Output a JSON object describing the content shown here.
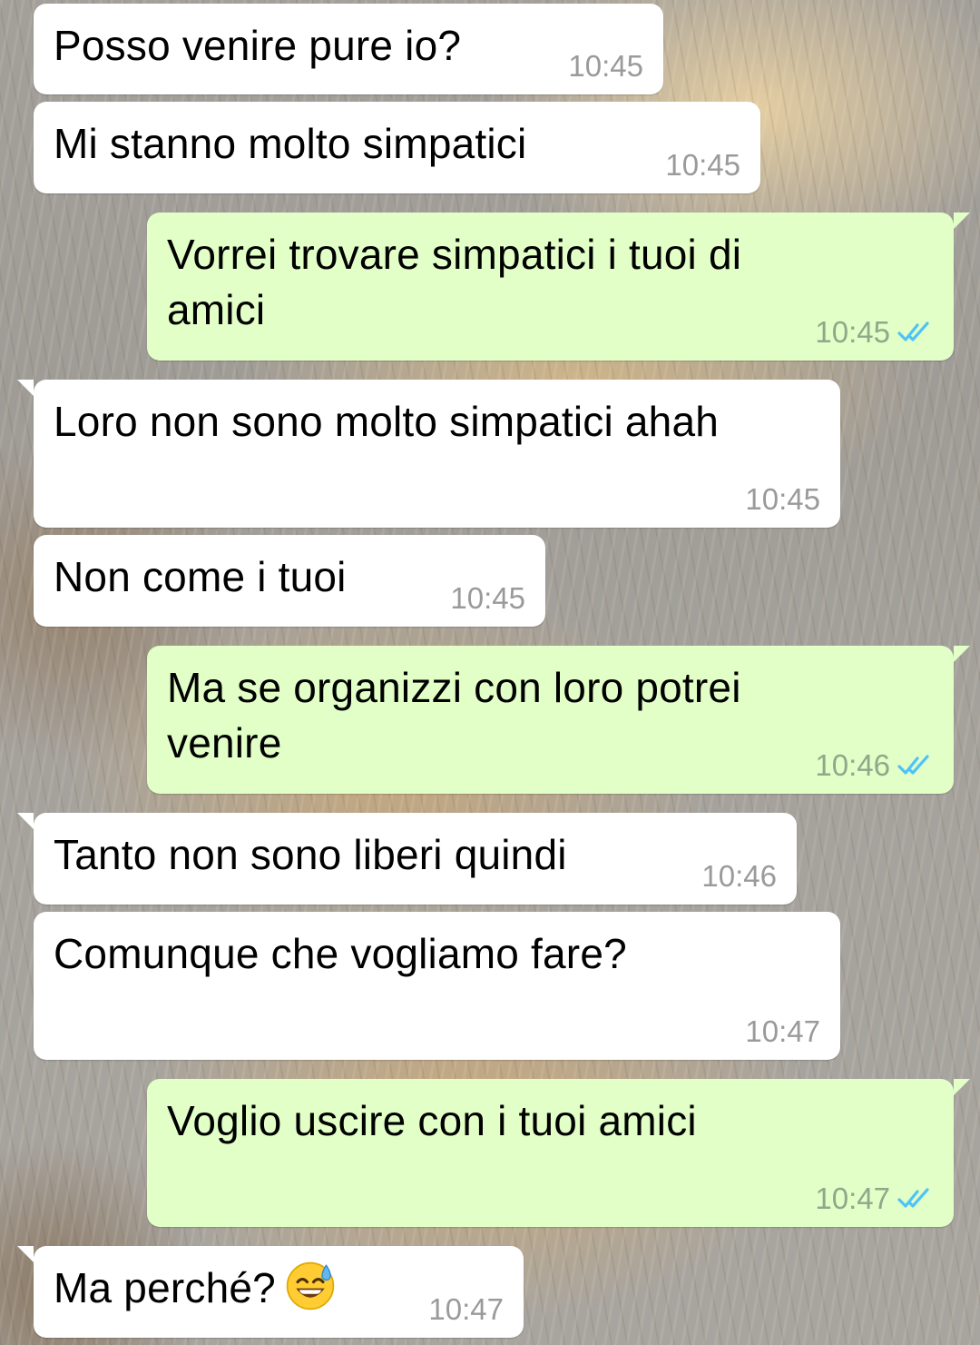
{
  "messages": [
    {
      "direction": "incoming",
      "text": "Posso venire pure io?",
      "time": "10:45"
    },
    {
      "direction": "incoming",
      "text": "Mi stanno molto simpatici",
      "time": "10:45"
    },
    {
      "direction": "outgoing",
      "text": "Vorrei trovare simpatici i tuoi di amici",
      "time": "10:45",
      "status": "double-check-read-icon"
    },
    {
      "direction": "incoming",
      "text": "Loro non sono molto simpatici ahah",
      "time": "10:45"
    },
    {
      "direction": "incoming",
      "text": "Non come i tuoi",
      "time": "10:45"
    },
    {
      "direction": "outgoing",
      "text": "Ma se organizzi con loro potrei venire",
      "time": "10:46",
      "status": "double-check-read-icon"
    },
    {
      "direction": "incoming",
      "text": "Tanto non sono liberi quindi",
      "time": "10:46"
    },
    {
      "direction": "incoming",
      "text": "Comunque che vogliamo fare?",
      "time": "10:47"
    },
    {
      "direction": "outgoing",
      "text": "Voglio uscire con i tuoi amici",
      "time": "10:47",
      "status": "double-check-read-icon"
    },
    {
      "direction": "incoming",
      "text": "Ma perché?",
      "time": "10:47",
      "emoji": "grinning-face-with-sweat-emoji"
    }
  ],
  "colors": {
    "incoming_bubble": "#ffffff",
    "outgoing_bubble": "#e1ffc7",
    "timestamp": "#9a9a9a",
    "read_ticks": "#4fc3f7"
  }
}
